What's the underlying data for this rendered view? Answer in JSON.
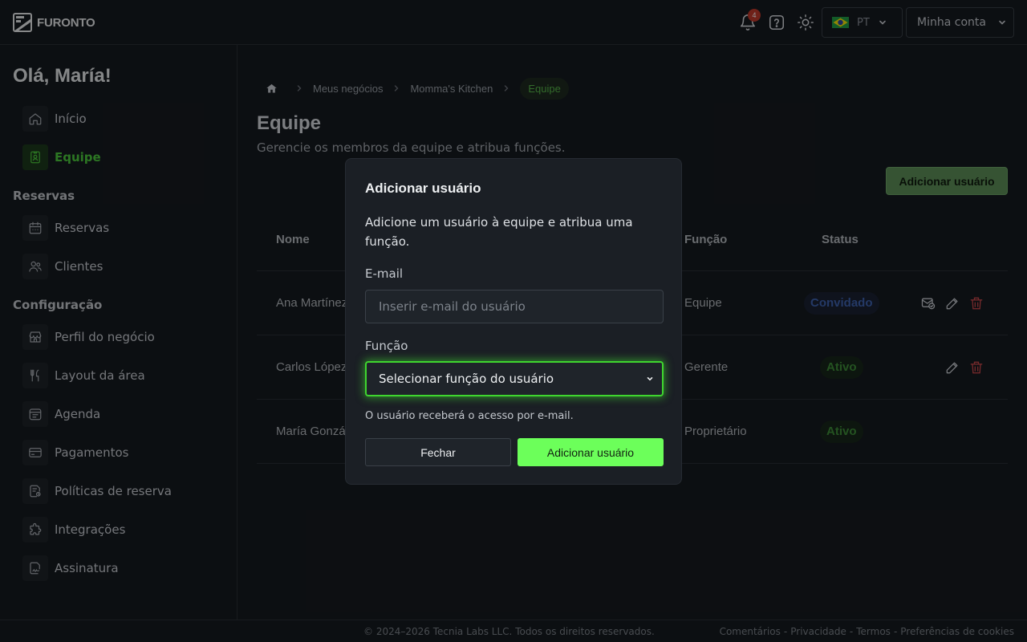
{
  "header": {
    "logo_text": "FURONTO",
    "notification_count": "4",
    "language": "PT",
    "account_label": "Minha conta"
  },
  "sidebar": {
    "greeting": "Olá, María!",
    "items_top": [
      {
        "label": "Início",
        "icon": "home-icon"
      },
      {
        "label": "Equipe",
        "icon": "badge-icon",
        "active": true
      }
    ],
    "section_reservas": "Reservas",
    "items_reservas": [
      {
        "label": "Reservas",
        "icon": "calendar-icon"
      },
      {
        "label": "Clientes",
        "icon": "users-icon"
      }
    ],
    "section_config": "Configuração",
    "items_config": [
      {
        "label": "Perfil do negócio",
        "icon": "store-icon"
      },
      {
        "label": "Layout da área",
        "icon": "utensils-icon"
      },
      {
        "label": "Agenda",
        "icon": "calendar-list-icon"
      },
      {
        "label": "Pagamentos",
        "icon": "credit-card-icon"
      },
      {
        "label": "Políticas de reserva",
        "icon": "policy-icon"
      },
      {
        "label": "Integrações",
        "icon": "puzzle-icon"
      },
      {
        "label": "Assinatura",
        "icon": "signature-icon"
      }
    ]
  },
  "breadcrumb": [
    "Meus negócios",
    "Momma's Kitchen",
    "Equipe"
  ],
  "page": {
    "title": "Equipe",
    "subtitle": "Gerencie os membros da equipe e atribua funções.",
    "add_button": "Adicionar usuário"
  },
  "table": {
    "headers": {
      "name": "Nome",
      "role": "Função",
      "status": "Status"
    },
    "rows": [
      {
        "name": "Ana Martínez",
        "role": "Equipe",
        "status": "Convidado"
      },
      {
        "name": "Carlos López",
        "role": "Gerente",
        "status": "Ativo"
      },
      {
        "name": "María Gonzál",
        "role": "Proprietário",
        "status": "Ativo"
      }
    ]
  },
  "modal": {
    "title": "Adicionar usuário",
    "description": "Adicione um usuário à equipe e atribua uma função.",
    "email_label": "E-mail",
    "email_placeholder": "Inserir e-mail do usuário",
    "role_label": "Função",
    "role_select": "Selecionar função do usuário",
    "help_text": "O usuário receberá o acesso por e-mail.",
    "close_button": "Fechar",
    "add_button": "Adicionar usuário"
  },
  "footer": {
    "copyright": "© 2024–2026 Tecnia Labs LLC. Todos os direitos reservados.",
    "links": [
      "Comentários",
      "Privacidade",
      "Termos",
      "Preferências de cookies"
    ]
  },
  "colors": {
    "accent": "#6cff5a",
    "focus_ring": "#3fd62f",
    "invited": "#3e63b0",
    "active": "#3f8f3a"
  }
}
